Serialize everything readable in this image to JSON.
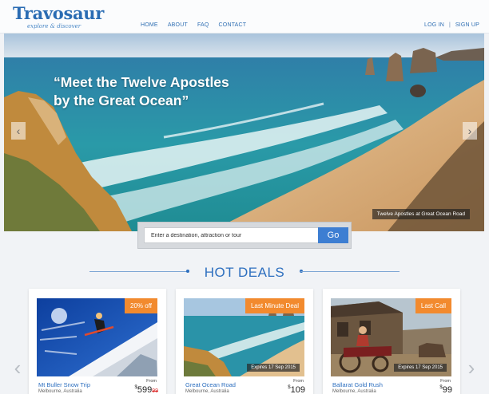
{
  "header": {
    "logo": "Travosaur",
    "tagline": "explore & discover",
    "nav": [
      "HOME",
      "ABOUT",
      "FAQ",
      "CONTACT"
    ],
    "login": "LOG IN",
    "separator": "|",
    "signup": "SIGN UP"
  },
  "hero": {
    "title_line1": "“Meet the Twelve Apostles",
    "title_line2": "by the Great Ocean”",
    "caption": "Twelve Apostles at Great Ocean Road",
    "prev_icon": "chevron-left-icon",
    "next_icon": "chevron-right-icon"
  },
  "search": {
    "placeholder": "Enter a destination, attraction or tour",
    "button": "Go"
  },
  "deals": {
    "title": "HOT DEALS",
    "items": [
      {
        "badge": "20% off",
        "expiry": "",
        "name": "Mt Buller Snow Trip",
        "location": "Melbourne, Australia",
        "from": "From",
        "currency": "$",
        "price": "599",
        "old_price": "99"
      },
      {
        "badge": "Last Minute Deal",
        "expiry": "Expires 17 Sep 2015",
        "name": "Great Ocean Road",
        "location": "Melbourne, Australia",
        "from": "From",
        "currency": "$",
        "price": "109",
        "old_price": ""
      },
      {
        "badge": "Last Call",
        "expiry": "Expires 17 Sep 2015",
        "name": "Ballarat Gold Rush",
        "location": "Melbourne, Australia",
        "from": "From",
        "currency": "$",
        "price": "99",
        "old_price": ""
      }
    ]
  },
  "colors": {
    "brand": "#2a6cb3",
    "accent": "#f28a2e",
    "button": "#3d7ed2"
  }
}
